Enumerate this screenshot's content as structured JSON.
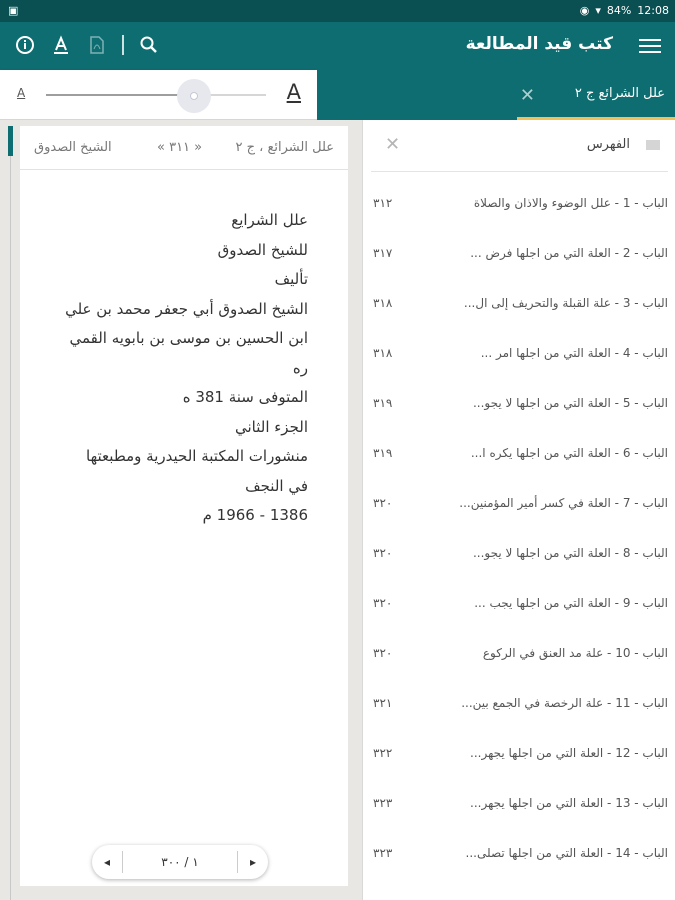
{
  "status": {
    "battery": "84%",
    "time": "12:08"
  },
  "appbar": {
    "title": "كتب قيد المطالعة"
  },
  "tab": {
    "label": "علل الشرائع ج ٢"
  },
  "reader": {
    "header": {
      "book": "علل الشرائع ، ج ٢",
      "page": "« ٣١١ »",
      "author": "الشيخ الصدوق"
    },
    "lines": [
      "علل الشرايع",
      "للشيخ الصدوق",
      "تأليف",
      "الشيخ الصدوق أبي جعفر محمد بن علي",
      "ابن الحسين بن موسى بن بابويه القمي",
      "ره",
      "المتوفى سنة 381 ه",
      "الجزء الثاني",
      "منشورات المكتبة الحيدرية ومطبعتها",
      "في النجف",
      "1386 - 1966 م"
    ],
    "pager": {
      "label": "١ / ٣٠٠",
      "prev": "◂",
      "next": "▸"
    }
  },
  "toc": {
    "title": "الفهرس",
    "items": [
      {
        "title": "الباب - 1 - علل الوضوء والاذان والصلاة",
        "page": "٣١٢"
      },
      {
        "title": "الباب - 2 - العلة التي من اجلها فرض ...",
        "page": "٣١٧"
      },
      {
        "title": "الباب - 3 - علة القبلة والتحريف إلى ال...",
        "page": "٣١٨"
      },
      {
        "title": "الباب - 4 - العلة التي من اجلها امر ...",
        "page": "٣١٨"
      },
      {
        "title": "الباب - 5 - العلة التي من اجلها لا يجو...",
        "page": "٣١٩"
      },
      {
        "title": "الباب - 6 - العلة التي من اجلها يكره ا...",
        "page": "٣١٩"
      },
      {
        "title": "الباب - 7 - العلة في كسر أمير المؤمنين...",
        "page": "٣٢٠"
      },
      {
        "title": "الباب - 8 - العلة التي من اجلها لا يجو...",
        "page": "٣٢٠"
      },
      {
        "title": "الباب - 9 - العلة التي من اجلها يجب ...",
        "page": "٣٢٠"
      },
      {
        "title": "الباب - 10 - علة مد العنق في الركوع",
        "page": "٣٢٠"
      },
      {
        "title": "الباب - 11 - علة الرخصة في الجمع بين...",
        "page": "٣٢١"
      },
      {
        "title": "الباب - 12 - العلة التي من اجلها يجهر...",
        "page": "٣٢٢"
      },
      {
        "title": "الباب - 13 - العلة التي من اجلها يجهر...",
        "page": "٣٢٣"
      },
      {
        "title": "الباب - 14 - العلة التي من اجلها تصلى...",
        "page": "٣٢٣"
      }
    ]
  },
  "font_slider": {
    "level": 0.68
  },
  "colors": {
    "primary": "#0d6d70",
    "statusbar": "#0a4f52",
    "accent": "#f0c05a"
  },
  "icons": [
    "image-icon",
    "info-icon",
    "text-format-icon",
    "pdf-icon",
    "search-icon",
    "menu-icon",
    "close-icon",
    "list-icon"
  ]
}
